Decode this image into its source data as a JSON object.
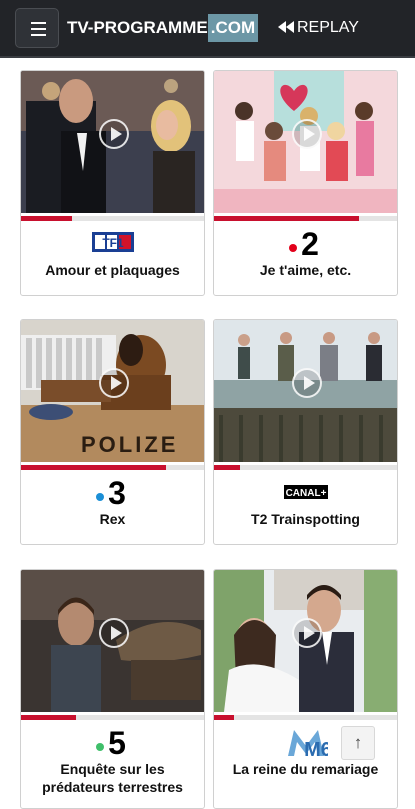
{
  "header": {
    "logo_main": "TV-PROGRAMME",
    "logo_suffix": ".COM",
    "replay_label": "REPLAY"
  },
  "cards": [
    {
      "title": "Amour et plaquages",
      "channel": "TF1",
      "progress": 0.28
    },
    {
      "title": "Je t'aime, etc.",
      "channel": "2",
      "progress": 0.79
    },
    {
      "title": "Rex",
      "channel": "3",
      "progress": 0.79
    },
    {
      "title": "T2 Trainspotting",
      "channel": "CANAL+",
      "progress": 0.14
    },
    {
      "title": "Enquête sur les prédateurs terrestres",
      "channel": "5",
      "progress": 0.3
    },
    {
      "title": "La reine du remariage",
      "channel": "M6",
      "progress": 0.11
    }
  ],
  "scroll_top_glyph": "↑",
  "colors": {
    "topbar": "#222428",
    "progress_fill": "#c8102e",
    "logo_accent": "#6c97a6"
  }
}
